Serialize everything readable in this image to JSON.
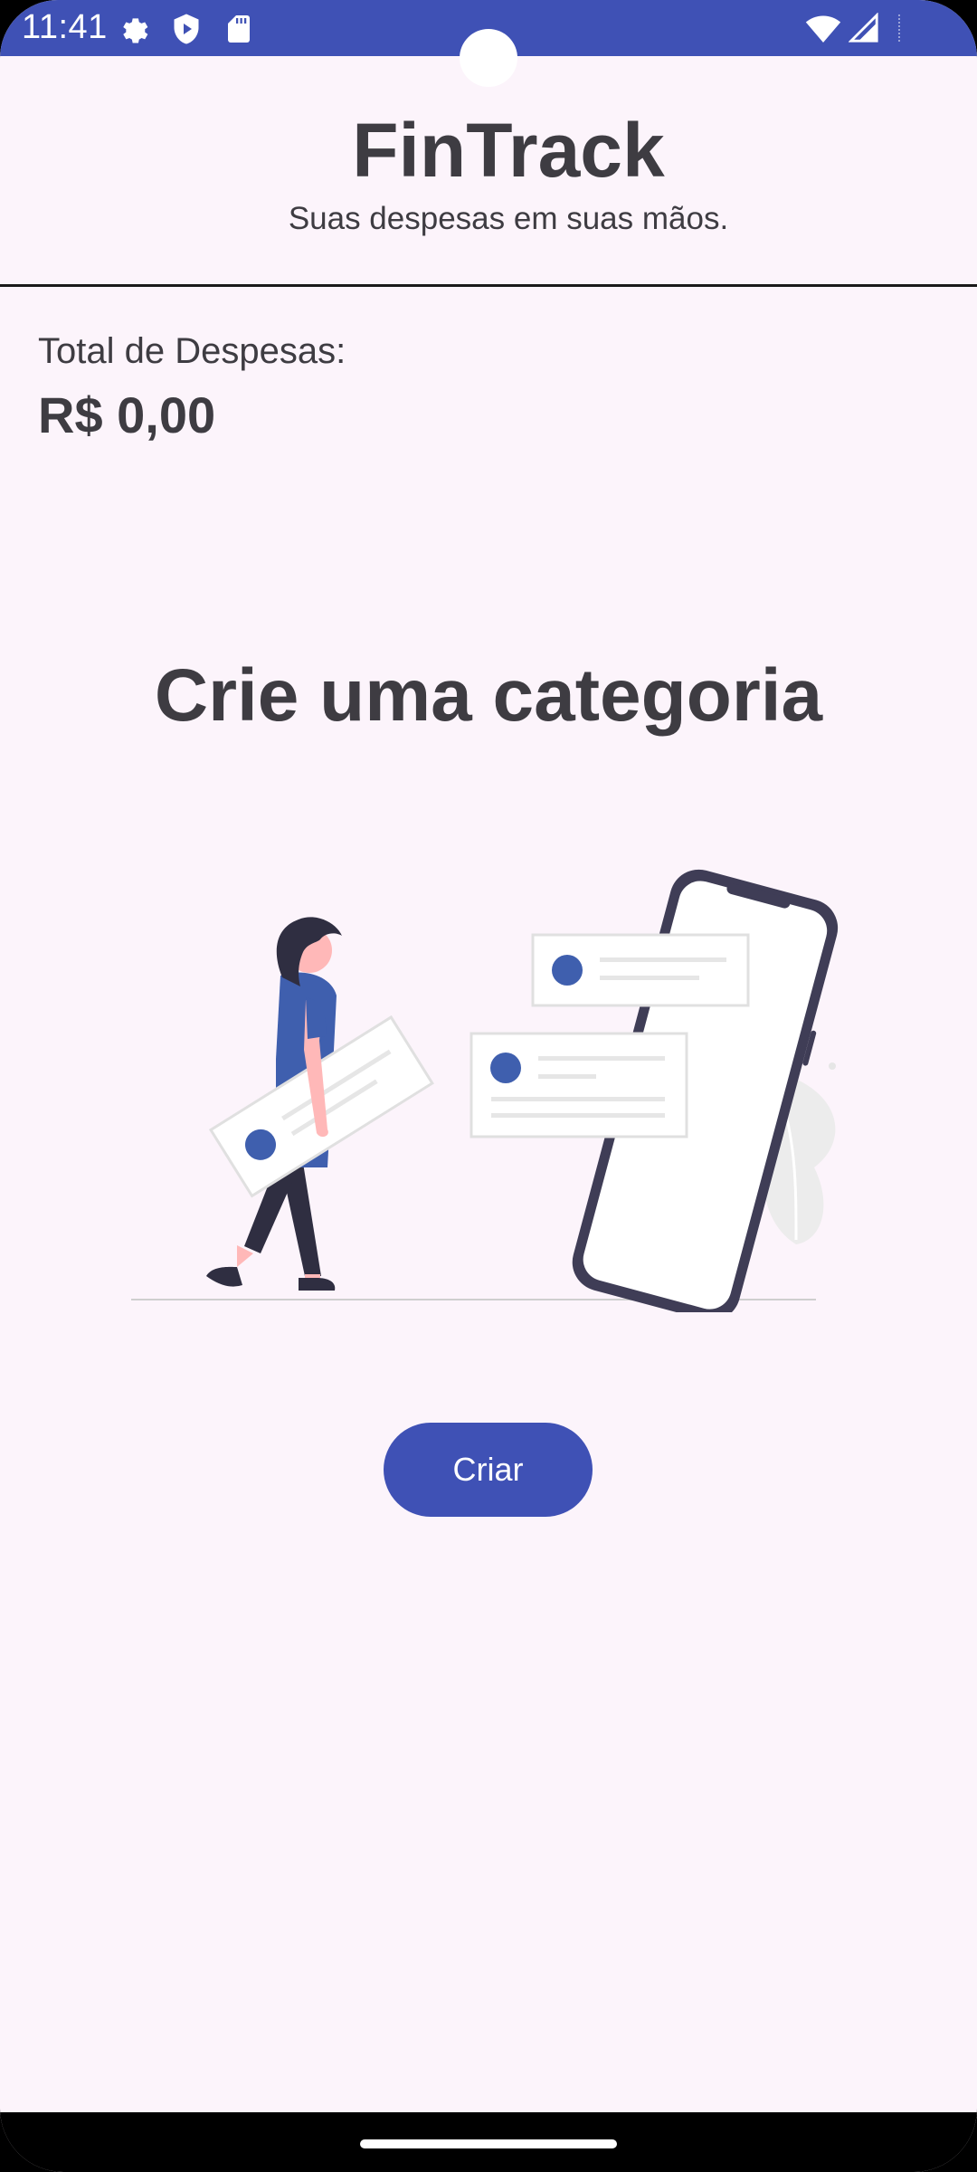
{
  "status_bar": {
    "time": "11:41",
    "icons": [
      "settings-icon",
      "shield-icon",
      "sd-card-icon",
      "wifi-icon",
      "signal-icon"
    ],
    "color": "#3f51b5"
  },
  "header": {
    "title": "FinTrack",
    "subtitle": "Suas despesas em suas mãos."
  },
  "summary": {
    "label": "Total de Despesas:",
    "value": "R$ 0,00"
  },
  "empty_state": {
    "title": "Crie uma categoria",
    "illustration": "woman-with-phone-cards-illustration"
  },
  "actions": {
    "create_label": "Criar"
  },
  "colors": {
    "accent": "#3f51b5",
    "background": "#fcf4fb",
    "text": "#3e3c42"
  }
}
